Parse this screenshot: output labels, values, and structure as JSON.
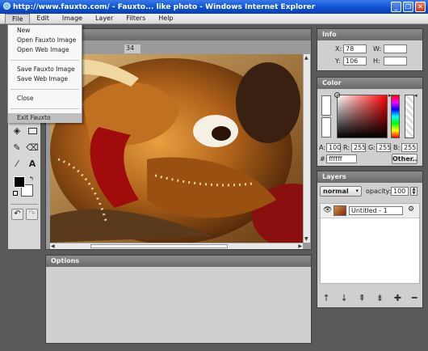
{
  "window": {
    "title": "http://www.fauxto.com/ - Fauxto... like photo - Windows Internet Explorer",
    "minimize": "_",
    "restore": "❐",
    "close": "✕"
  },
  "menubar": {
    "items": [
      "File",
      "Edit",
      "Image",
      "Layer",
      "Filters",
      "Help"
    ]
  },
  "file_menu": {
    "items": [
      "New",
      "Open Fauxto Image",
      "Open Web Image",
      "Save Fauxto Image",
      "Save Web Image",
      "Close",
      "Exit Fauxto"
    ]
  },
  "canvas": {
    "tab_fragment": "34"
  },
  "tools": {
    "text_tool": "A"
  },
  "info": {
    "title": "Info",
    "x_label": "X:",
    "x_value": "78",
    "y_label": "Y:",
    "y_value": "106",
    "w_label": "W:",
    "w_value": "",
    "h_label": "H:",
    "h_value": ""
  },
  "color": {
    "title": "Color",
    "a_label": "A:",
    "a_value": "100",
    "r_label": "R:",
    "r_value": "255",
    "g_label": "G:",
    "g_value": "255",
    "b_label": "B:",
    "b_value": "255",
    "hex_label": "#:",
    "hex_value": "ffffff",
    "other_button": "Other..",
    "current_color": "#ffffff",
    "hue_color": "#ff0000"
  },
  "layers": {
    "title": "Layers",
    "blend_mode": "normal",
    "opacity_label": "opacity:",
    "opacity_value": "100",
    "layer_name": "Untitled - 1"
  },
  "options": {
    "title": "Options"
  },
  "colors": {
    "titlebar": "#0a4fd0",
    "panel_header": "#7a7a7a",
    "workspace": "#5a5a5a"
  }
}
